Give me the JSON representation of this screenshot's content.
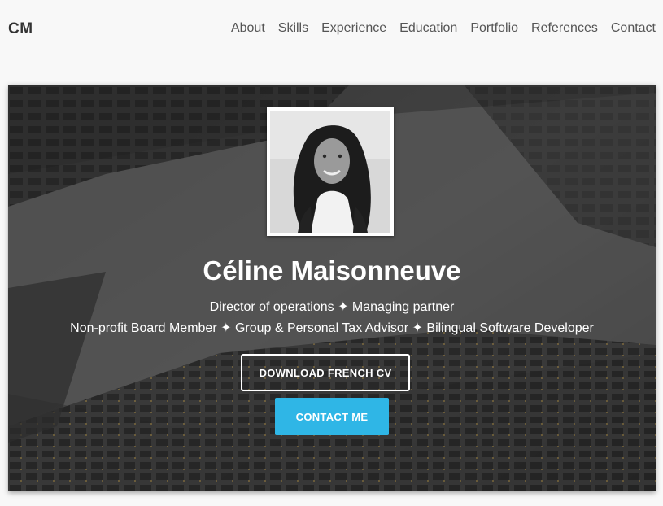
{
  "brand": "CM",
  "nav": {
    "items": [
      {
        "label": "About"
      },
      {
        "label": "Skills"
      },
      {
        "label": "Experience"
      },
      {
        "label": "Education"
      },
      {
        "label": "Portfolio"
      },
      {
        "label": "References"
      },
      {
        "label": "Contact"
      }
    ]
  },
  "hero": {
    "name": "Céline Maisonneuve",
    "subtitle_line1": "Director of operations ✦ Managing partner",
    "subtitle_line2": "Non-profit Board Member ✦ Group & Personal Tax Advisor ✦ Bilingual Software Developer",
    "download_button": "DOWNLOAD FRENCH CV",
    "contact_button": "CONTACT ME"
  },
  "colors": {
    "accent": "#2fb6e6",
    "page_background": "#f8f8f8",
    "nav_text": "#555555"
  }
}
